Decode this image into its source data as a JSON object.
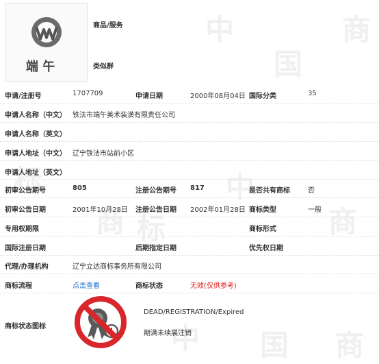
{
  "header": {
    "goods_label": "商品/服务",
    "similar_group_label": "类似群",
    "mark_text": "端 午"
  },
  "rows": {
    "app_number": {
      "label": "申请/注册号",
      "value": "1707709"
    },
    "app_date": {
      "label": "申请日期",
      "value": "2000年08月04日"
    },
    "intl_class": {
      "label": "国际分类",
      "value": "35"
    },
    "applicant_cn": {
      "label": "申请人名称（中文）",
      "value": "铁法市端午美术装潢有限责任公司"
    },
    "applicant_en": {
      "label": "申请人名称（英文）",
      "value": ""
    },
    "address_cn": {
      "label": "申请人地址（中文）",
      "value": "辽宁铁法市站前小区"
    },
    "address_en": {
      "label": "申请人地址（英文）",
      "value": ""
    },
    "prelim_issue": {
      "label": "初审公告期号",
      "value": "805"
    },
    "reg_issue": {
      "label": "注册公告期号",
      "value": "817"
    },
    "shared": {
      "label": "是否共有商标",
      "value": "否"
    },
    "prelim_date": {
      "label": "初审公告日期",
      "value": "2001年10月28日"
    },
    "reg_date": {
      "label": "注册公告日期",
      "value": "2002年01月28日"
    },
    "mark_type": {
      "label": "商标类型",
      "value": "一般"
    },
    "exclusive_period": {
      "label": "专用权期限",
      "value": ""
    },
    "mark_form": {
      "label": "商标形式",
      "value": ""
    },
    "intl_reg_date": {
      "label": "国际注册日期",
      "value": ""
    },
    "later_designation": {
      "label": "后期指定日期",
      "value": ""
    },
    "priority_date": {
      "label": "优先权日期",
      "value": ""
    },
    "agent": {
      "label": "代理/办理机构",
      "value": "辽宁立达商标事务所有限公司"
    },
    "process": {
      "label": "商标流程",
      "link": "点击查看"
    },
    "status": {
      "label": "商标状态",
      "value": "无效",
      "note": "(仅供参考)"
    },
    "status_icon": {
      "label": "商标状态图标",
      "status_en": "DEAD/REGISTRATION/Expired",
      "status_cn": "期满未续展注销"
    }
  },
  "colors": {
    "link": "#1a6fd0",
    "red": "#e02020",
    "icon_red": "#d8262b",
    "icon_dark": "#5a5a5a"
  }
}
